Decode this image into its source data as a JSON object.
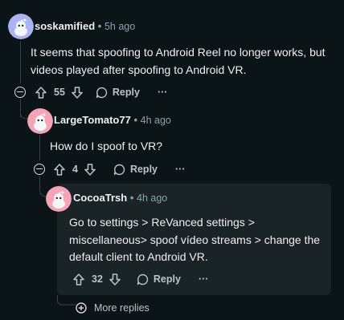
{
  "comments": [
    {
      "username": "soskamified",
      "separator": "•",
      "time": "5h ago",
      "body_lines": [
        "It seems that spoofing to Android Reel no longer works, but",
        "videos played after spoofing to Android VR."
      ],
      "score": "55",
      "reply_label": "Reply",
      "more_label": "···"
    },
    {
      "username": "LargeTomato77",
      "separator": "•",
      "time": "4h ago",
      "body_lines": [
        "How do I spoof to VR?"
      ],
      "score": "4",
      "reply_label": "Reply",
      "more_label": "···"
    },
    {
      "username": "CocoaTrsh",
      "separator": "•",
      "time": "4h ago",
      "body_lines": [
        "Go to settings > ReVanced settings >",
        "miscellaneous> spoof vídeo streams > change the",
        "default client to Android VR."
      ],
      "score": "32",
      "reply_label": "Reply",
      "more_label": "···"
    }
  ],
  "more_replies": "More replies",
  "colors": {
    "background": "#0b1416",
    "highlight": "#1a2326",
    "avatar_1": "#a9b4f4",
    "avatar_2": "#f6a3b3",
    "avatar_3": "#f6a3b3"
  }
}
